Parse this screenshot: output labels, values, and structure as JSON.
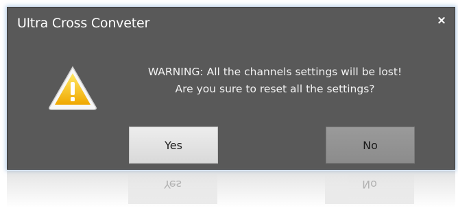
{
  "dialog": {
    "title": "Ultra Cross Conveter",
    "close_label": "×",
    "icon": "warning-icon",
    "message_line1": "WARNING: All the channels settings will be lost!",
    "message_line2": "Are you sure to reset all the settings?",
    "yes_label": "Yes",
    "no_label": "No"
  },
  "colors": {
    "dialog_bg": "#595959",
    "accent_glow": "#8cb4dc",
    "warning_yellow": "#f5c400"
  }
}
